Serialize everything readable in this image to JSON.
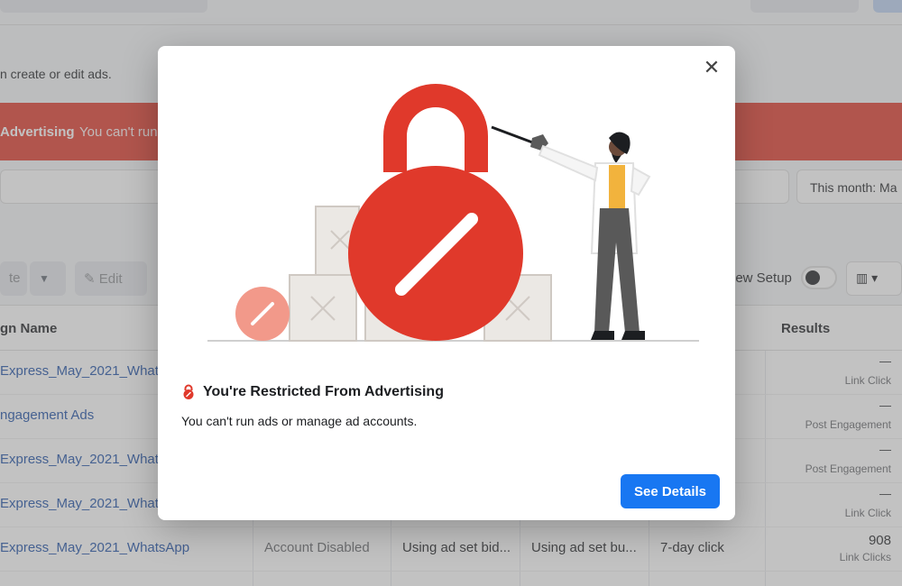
{
  "background": {
    "info_text": "n create or edit ads.",
    "banner": {
      "title": "Advertising",
      "text": "You can't run"
    },
    "date_filter": "This month: Ma",
    "toolbar": {
      "create_label": "te",
      "edit_label": "Edit",
      "review_setup_label": "iew Setup",
      "columns_icon": "columns-icon"
    },
    "table": {
      "name_header": "gn Name",
      "results_header": "Results",
      "rows": [
        {
          "name": "Express_May_2021_Whats",
          "result_value": "—",
          "result_label": "Link Click"
        },
        {
          "name": "ngagement Ads",
          "result_value": "—",
          "result_label": "Post Engagement"
        },
        {
          "name": "Express_May_2021_Whats",
          "result_value": "—",
          "result_label": "Post Engagement"
        },
        {
          "name": "Express_May_2021_Whats",
          "result_value": "—",
          "result_label": "Link Click"
        },
        {
          "name": "Express_May_2021_WhatsApp",
          "delivery": "Account Disabled",
          "bid": "Using ad set bid...",
          "budget": "Using ad set bu...",
          "attribution": "7-day click",
          "result_value": "908",
          "result_label": "Link Clicks"
        }
      ]
    }
  },
  "modal": {
    "title": "You're Restricted From Advertising",
    "description": "You can't run ads or manage ad accounts.",
    "button_label": "See Details",
    "close_icon": "close-icon",
    "colors": {
      "accent_red": "#e0392b",
      "button_blue": "#1877f2"
    }
  }
}
